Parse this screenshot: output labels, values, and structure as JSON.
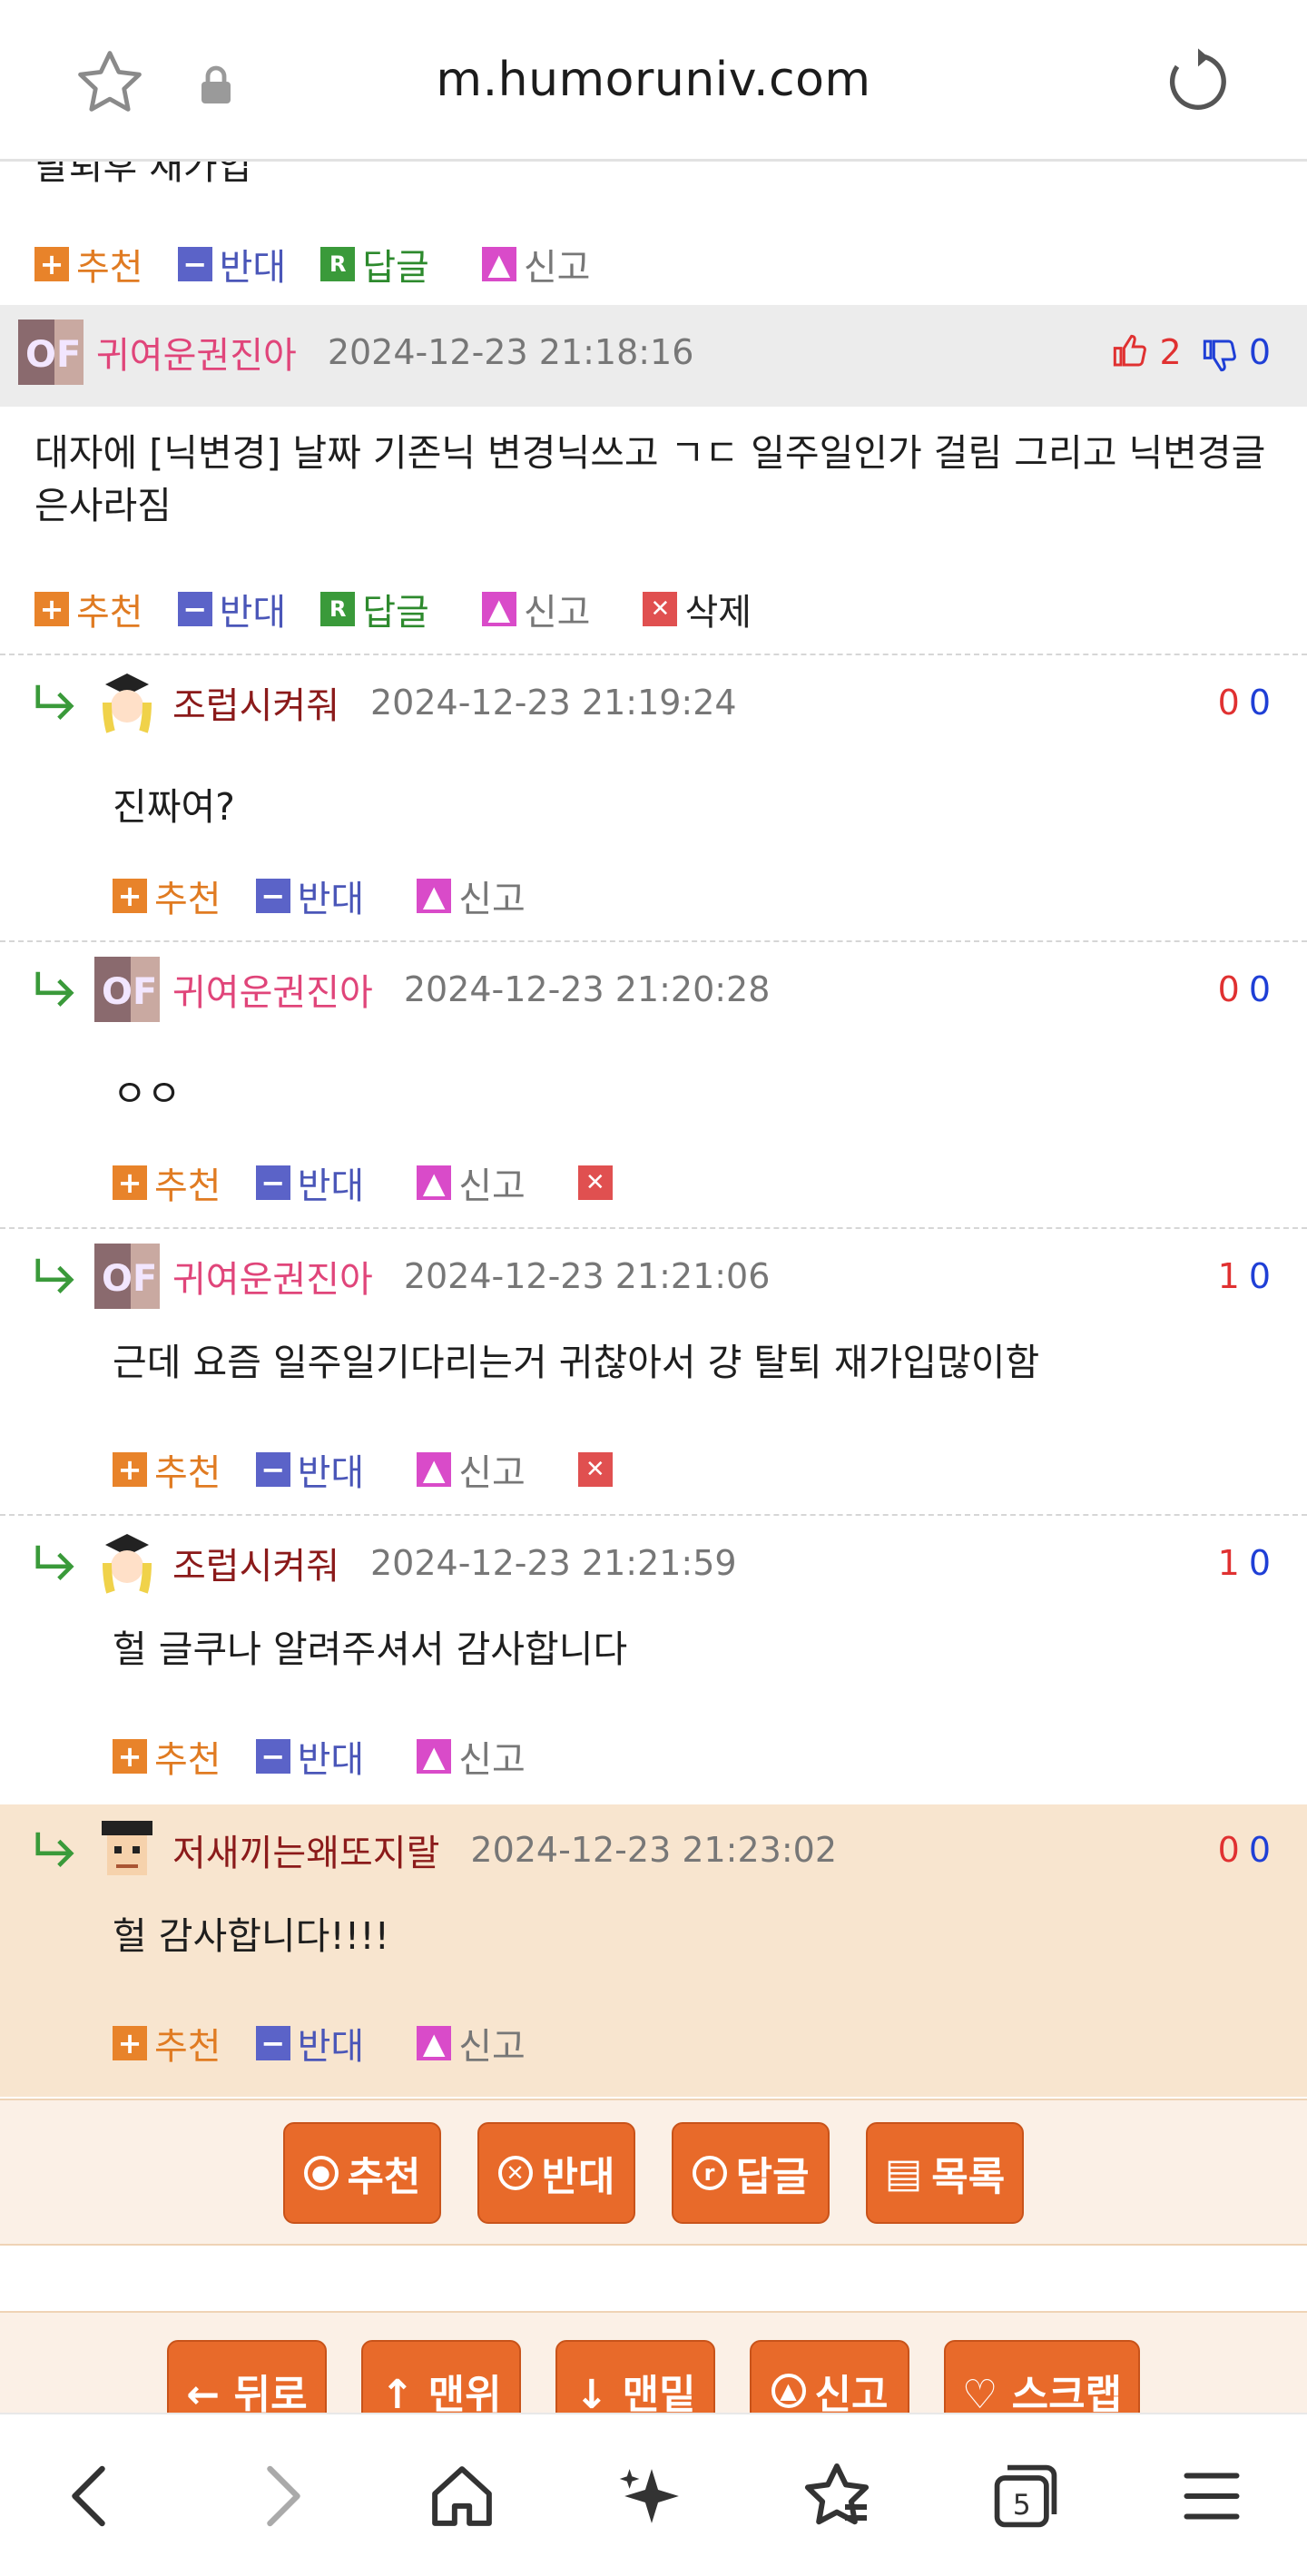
{
  "browser": {
    "url": "m.humoruniv.com",
    "tab_count": "5"
  },
  "partial_text": "탈퇴후 재가입",
  "labels": {
    "recommend": "추천",
    "oppose": "반대",
    "reply": "답글",
    "report": "신고",
    "delete": "삭제"
  },
  "main_comment": {
    "nick": "귀여운권진아",
    "date": "2024-12-23 21:18:16",
    "up": "2",
    "down": "0",
    "body": "대자에 [닉변경] 날짜 기존닉 변경닉쓰고 ㄱㄷ 일주일인가 걸림 그리고 닉변경글은사라짐"
  },
  "replies": [
    {
      "nick": "조럽시켜줘",
      "date": "2024-12-23 21:19:24",
      "up": "0",
      "down": "0",
      "body": "진짜여?"
    },
    {
      "nick": "귀여운권진아",
      "date": "2024-12-23 21:20:28",
      "up": "0",
      "down": "0",
      "body": "ㅇㅇ"
    },
    {
      "nick": "귀여운권진아",
      "date": "2024-12-23 21:21:06",
      "up": "1",
      "down": "0",
      "body": "근데 요즘 일주일기다리는거 귀찮아서 걍 탈퇴 재가입많이함"
    },
    {
      "nick": "조럽시켜줘",
      "date": "2024-12-23 21:21:59",
      "up": "1",
      "down": "0",
      "body": "헐 글쿠나 알려주셔서 감사합니다"
    },
    {
      "nick": "저새끼는왜또지랄",
      "date": "2024-12-23 21:23:02",
      "up": "0",
      "down": "0",
      "body": "헐 감사합니다!!!!"
    }
  ],
  "article_buttons": {
    "recommend": "추천",
    "oppose": "반대",
    "reply": "답글",
    "list": "목록"
  },
  "nav_buttons": {
    "back": "← 뒤로",
    "top": "↑ 맨위",
    "bottom": "↓ 맨밑",
    "report": "신고",
    "scrap": "♡ 스크랩"
  },
  "colors": {
    "accent": "#e86a2a",
    "highlight_bg": "#f8e5cf",
    "nick_pink": "#e0457a",
    "nick_dark": "#8b1a1a"
  }
}
